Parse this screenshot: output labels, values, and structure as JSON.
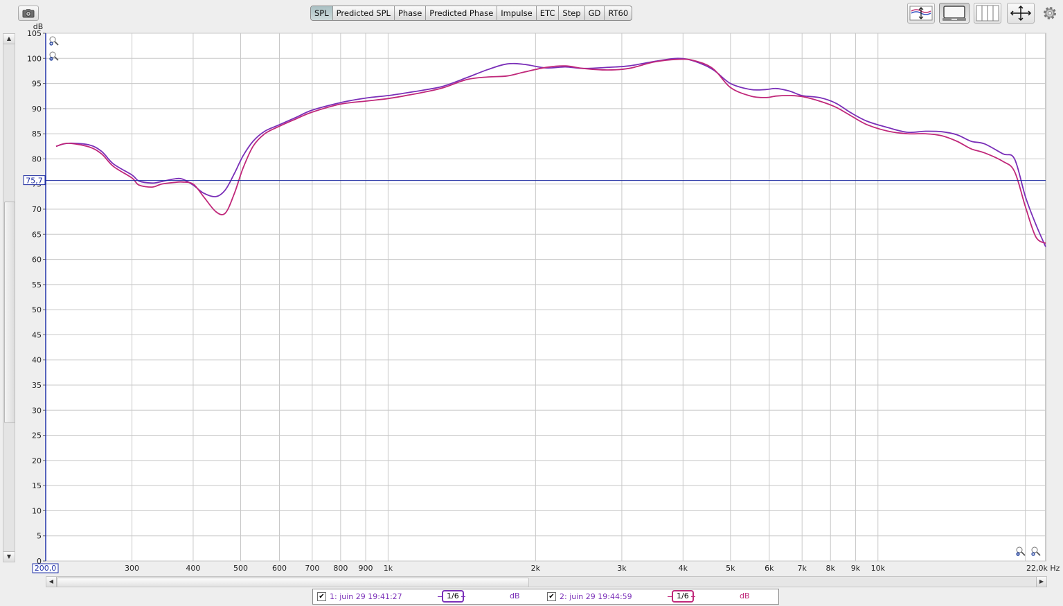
{
  "toolbar": {
    "tabs": [
      {
        "label": "SPL",
        "active": true
      },
      {
        "label": "Predicted SPL",
        "active": false
      },
      {
        "label": "Phase",
        "active": false
      },
      {
        "label": "Predicted Phase",
        "active": false
      },
      {
        "label": "Impulse",
        "active": false
      },
      {
        "label": "ETC",
        "active": false
      },
      {
        "label": "Step",
        "active": false
      },
      {
        "label": "GD",
        "active": false
      },
      {
        "label": "RT60",
        "active": false
      }
    ],
    "icons": [
      "camera-icon",
      "curve-arrows-icon",
      "overlay-screen-icon",
      "vertical-lines-icon",
      "pan-arrows-icon",
      "gear-icon"
    ]
  },
  "chart_data": {
    "type": "line",
    "x_scale": "log",
    "xlim": [
      200,
      22000
    ],
    "ylim": [
      0,
      105
    ],
    "ylabel": "dB",
    "xunit": "Hz",
    "x_start_label": "200,0",
    "x_end_label": "22,0k",
    "y_ticks": [
      0,
      5,
      10,
      15,
      20,
      25,
      30,
      35,
      40,
      45,
      50,
      55,
      60,
      65,
      70,
      75,
      80,
      85,
      90,
      95,
      100,
      105
    ],
    "x_ticks": [
      {
        "value": 300,
        "label": "300"
      },
      {
        "value": 400,
        "label": "400"
      },
      {
        "value": 500,
        "label": "500"
      },
      {
        "value": 600,
        "label": "600"
      },
      {
        "value": 700,
        "label": "700"
      },
      {
        "value": 800,
        "label": "800"
      },
      {
        "value": 900,
        "label": "900"
      },
      {
        "value": 1000,
        "label": "1k"
      },
      {
        "value": 2000,
        "label": "2k"
      },
      {
        "value": 3000,
        "label": "3k"
      },
      {
        "value": 4000,
        "label": "4k"
      },
      {
        "value": 5000,
        "label": "5k"
      },
      {
        "value": 6000,
        "label": "6k"
      },
      {
        "value": 7000,
        "label": "7k"
      },
      {
        "value": 8000,
        "label": "8k"
      },
      {
        "value": 9000,
        "label": "9k"
      },
      {
        "value": 10000,
        "label": "10k"
      }
    ],
    "minor_x_grid": [
      20000
    ],
    "reference_line": {
      "value": 75.7,
      "label": "75,7",
      "color": "#1b2aa0"
    },
    "grid": true,
    "series": [
      {
        "color": "#7a2fb8",
        "x": [
          210,
          222,
          245,
          260,
          275,
          300,
          310,
          330,
          345,
          365,
          380,
          400,
          420,
          445,
          465,
          485,
          505,
          530,
          560,
          600,
          650,
          700,
          800,
          900,
          1000,
          1100,
          1200,
          1300,
          1450,
          1600,
          1750,
          1900,
          2100,
          2300,
          2500,
          2800,
          3100,
          3500,
          3900,
          4200,
          4600,
          5000,
          5500,
          5900,
          6200,
          6600,
          7000,
          7600,
          8200,
          8800,
          9500,
          10500,
          11500,
          12500,
          13500,
          14500,
          15500,
          16500,
          18000,
          19000,
          20000,
          21000,
          22000
        ],
        "y": [
          82.5,
          83.1,
          82.8,
          81.5,
          79.0,
          76.8,
          75.6,
          75.2,
          75.5,
          76.0,
          76.0,
          74.8,
          73.2,
          72.5,
          73.8,
          77.0,
          80.5,
          83.5,
          85.5,
          86.8,
          88.3,
          89.7,
          91.2,
          92.1,
          92.6,
          93.2,
          93.8,
          94.5,
          96.2,
          97.8,
          98.9,
          98.8,
          98.1,
          98.3,
          98.0,
          98.2,
          98.5,
          99.4,
          100.0,
          99.5,
          97.8,
          95.0,
          93.8,
          93.8,
          94.0,
          93.5,
          92.6,
          92.2,
          91.1,
          89.2,
          87.5,
          86.2,
          85.3,
          85.5,
          85.4,
          84.8,
          83.5,
          83.0,
          81.0,
          80.0,
          72.5,
          67.0,
          62.5
        ]
      },
      {
        "color": "#c0287a",
        "x": [
          210,
          222,
          245,
          260,
          275,
          300,
          310,
          330,
          345,
          365,
          380,
          400,
          420,
          445,
          465,
          485,
          505,
          530,
          560,
          600,
          650,
          700,
          800,
          900,
          1000,
          1100,
          1200,
          1300,
          1450,
          1600,
          1750,
          1900,
          2100,
          2300,
          2500,
          2800,
          3100,
          3500,
          3900,
          4200,
          4600,
          5000,
          5500,
          5900,
          6200,
          6600,
          7000,
          7600,
          8200,
          8800,
          9500,
          10500,
          11500,
          12500,
          13500,
          14500,
          15500,
          16500,
          18000,
          19000,
          20000,
          21000,
          22000
        ],
        "y": [
          82.5,
          83.1,
          82.4,
          81.0,
          78.5,
          76.2,
          74.8,
          74.4,
          75.0,
          75.3,
          75.4,
          75.0,
          72.5,
          69.5,
          69.2,
          73.0,
          78.0,
          82.5,
          85.0,
          86.5,
          88.0,
          89.3,
          90.9,
          91.5,
          92.0,
          92.7,
          93.4,
          94.2,
          95.8,
          96.3,
          96.5,
          97.3,
          98.2,
          98.5,
          98.0,
          97.7,
          98.0,
          99.3,
          99.8,
          99.6,
          98.0,
          94.2,
          92.5,
          92.2,
          92.5,
          92.6,
          92.4,
          91.5,
          90.3,
          88.6,
          86.8,
          85.5,
          85.0,
          85.0,
          84.6,
          83.5,
          82.0,
          81.2,
          79.5,
          77.5,
          70.5,
          64.5,
          63.2
        ]
      }
    ]
  },
  "legend": {
    "entries": [
      {
        "checked": true,
        "name": "1: juin 29 19:41:27",
        "smoothing": "1/6",
        "unit": "dB",
        "color": "#7a2fb8",
        "name_color": "#7a2fb8"
      },
      {
        "checked": true,
        "name": "2: juin 29 19:44:59",
        "smoothing": "1/6",
        "unit": "dB",
        "color": "#c0287a",
        "name_color": "#7a2fb8"
      }
    ]
  }
}
